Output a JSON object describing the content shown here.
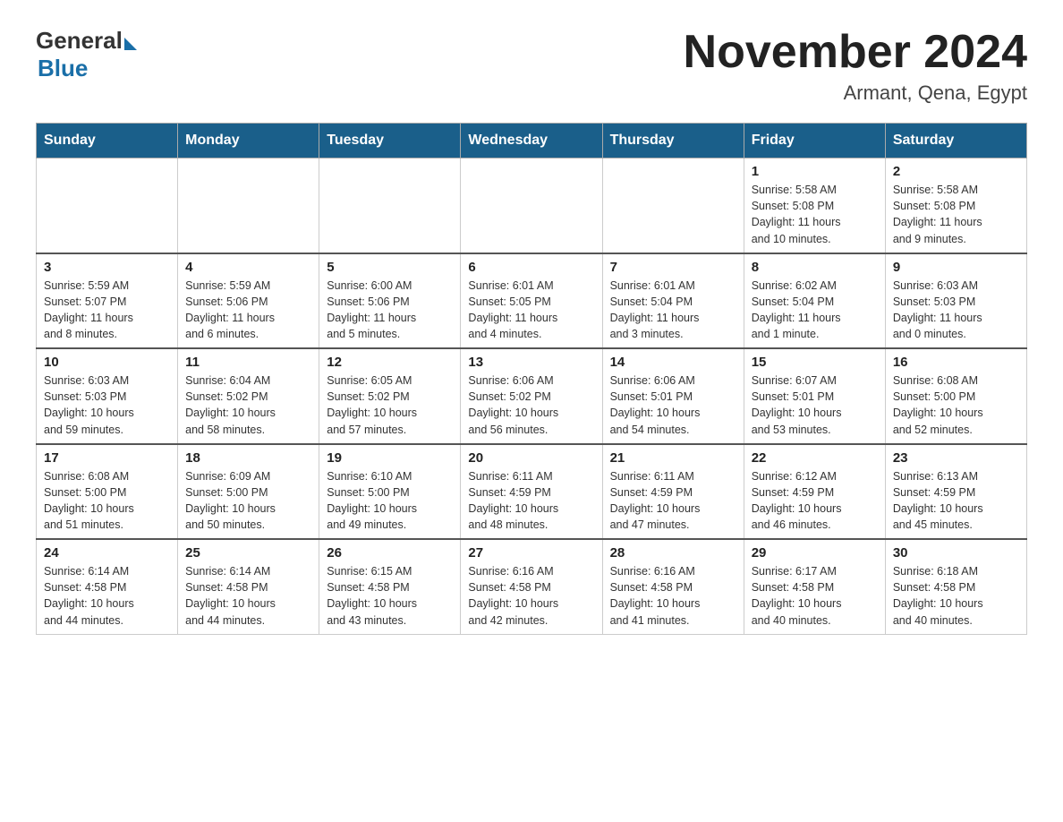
{
  "header": {
    "logo_general": "General",
    "logo_blue": "Blue",
    "month_title": "November 2024",
    "location": "Armant, Qena, Egypt"
  },
  "weekdays": [
    "Sunday",
    "Monday",
    "Tuesday",
    "Wednesday",
    "Thursday",
    "Friday",
    "Saturday"
  ],
  "weeks": [
    [
      {
        "day": "",
        "info": ""
      },
      {
        "day": "",
        "info": ""
      },
      {
        "day": "",
        "info": ""
      },
      {
        "day": "",
        "info": ""
      },
      {
        "day": "",
        "info": ""
      },
      {
        "day": "1",
        "info": "Sunrise: 5:58 AM\nSunset: 5:08 PM\nDaylight: 11 hours\nand 10 minutes."
      },
      {
        "day": "2",
        "info": "Sunrise: 5:58 AM\nSunset: 5:08 PM\nDaylight: 11 hours\nand 9 minutes."
      }
    ],
    [
      {
        "day": "3",
        "info": "Sunrise: 5:59 AM\nSunset: 5:07 PM\nDaylight: 11 hours\nand 8 minutes."
      },
      {
        "day": "4",
        "info": "Sunrise: 5:59 AM\nSunset: 5:06 PM\nDaylight: 11 hours\nand 6 minutes."
      },
      {
        "day": "5",
        "info": "Sunrise: 6:00 AM\nSunset: 5:06 PM\nDaylight: 11 hours\nand 5 minutes."
      },
      {
        "day": "6",
        "info": "Sunrise: 6:01 AM\nSunset: 5:05 PM\nDaylight: 11 hours\nand 4 minutes."
      },
      {
        "day": "7",
        "info": "Sunrise: 6:01 AM\nSunset: 5:04 PM\nDaylight: 11 hours\nand 3 minutes."
      },
      {
        "day": "8",
        "info": "Sunrise: 6:02 AM\nSunset: 5:04 PM\nDaylight: 11 hours\nand 1 minute."
      },
      {
        "day": "9",
        "info": "Sunrise: 6:03 AM\nSunset: 5:03 PM\nDaylight: 11 hours\nand 0 minutes."
      }
    ],
    [
      {
        "day": "10",
        "info": "Sunrise: 6:03 AM\nSunset: 5:03 PM\nDaylight: 10 hours\nand 59 minutes."
      },
      {
        "day": "11",
        "info": "Sunrise: 6:04 AM\nSunset: 5:02 PM\nDaylight: 10 hours\nand 58 minutes."
      },
      {
        "day": "12",
        "info": "Sunrise: 6:05 AM\nSunset: 5:02 PM\nDaylight: 10 hours\nand 57 minutes."
      },
      {
        "day": "13",
        "info": "Sunrise: 6:06 AM\nSunset: 5:02 PM\nDaylight: 10 hours\nand 56 minutes."
      },
      {
        "day": "14",
        "info": "Sunrise: 6:06 AM\nSunset: 5:01 PM\nDaylight: 10 hours\nand 54 minutes."
      },
      {
        "day": "15",
        "info": "Sunrise: 6:07 AM\nSunset: 5:01 PM\nDaylight: 10 hours\nand 53 minutes."
      },
      {
        "day": "16",
        "info": "Sunrise: 6:08 AM\nSunset: 5:00 PM\nDaylight: 10 hours\nand 52 minutes."
      }
    ],
    [
      {
        "day": "17",
        "info": "Sunrise: 6:08 AM\nSunset: 5:00 PM\nDaylight: 10 hours\nand 51 minutes."
      },
      {
        "day": "18",
        "info": "Sunrise: 6:09 AM\nSunset: 5:00 PM\nDaylight: 10 hours\nand 50 minutes."
      },
      {
        "day": "19",
        "info": "Sunrise: 6:10 AM\nSunset: 5:00 PM\nDaylight: 10 hours\nand 49 minutes."
      },
      {
        "day": "20",
        "info": "Sunrise: 6:11 AM\nSunset: 4:59 PM\nDaylight: 10 hours\nand 48 minutes."
      },
      {
        "day": "21",
        "info": "Sunrise: 6:11 AM\nSunset: 4:59 PM\nDaylight: 10 hours\nand 47 minutes."
      },
      {
        "day": "22",
        "info": "Sunrise: 6:12 AM\nSunset: 4:59 PM\nDaylight: 10 hours\nand 46 minutes."
      },
      {
        "day": "23",
        "info": "Sunrise: 6:13 AM\nSunset: 4:59 PM\nDaylight: 10 hours\nand 45 minutes."
      }
    ],
    [
      {
        "day": "24",
        "info": "Sunrise: 6:14 AM\nSunset: 4:58 PM\nDaylight: 10 hours\nand 44 minutes."
      },
      {
        "day": "25",
        "info": "Sunrise: 6:14 AM\nSunset: 4:58 PM\nDaylight: 10 hours\nand 44 minutes."
      },
      {
        "day": "26",
        "info": "Sunrise: 6:15 AM\nSunset: 4:58 PM\nDaylight: 10 hours\nand 43 minutes."
      },
      {
        "day": "27",
        "info": "Sunrise: 6:16 AM\nSunset: 4:58 PM\nDaylight: 10 hours\nand 42 minutes."
      },
      {
        "day": "28",
        "info": "Sunrise: 6:16 AM\nSunset: 4:58 PM\nDaylight: 10 hours\nand 41 minutes."
      },
      {
        "day": "29",
        "info": "Sunrise: 6:17 AM\nSunset: 4:58 PM\nDaylight: 10 hours\nand 40 minutes."
      },
      {
        "day": "30",
        "info": "Sunrise: 6:18 AM\nSunset: 4:58 PM\nDaylight: 10 hours\nand 40 minutes."
      }
    ]
  ]
}
